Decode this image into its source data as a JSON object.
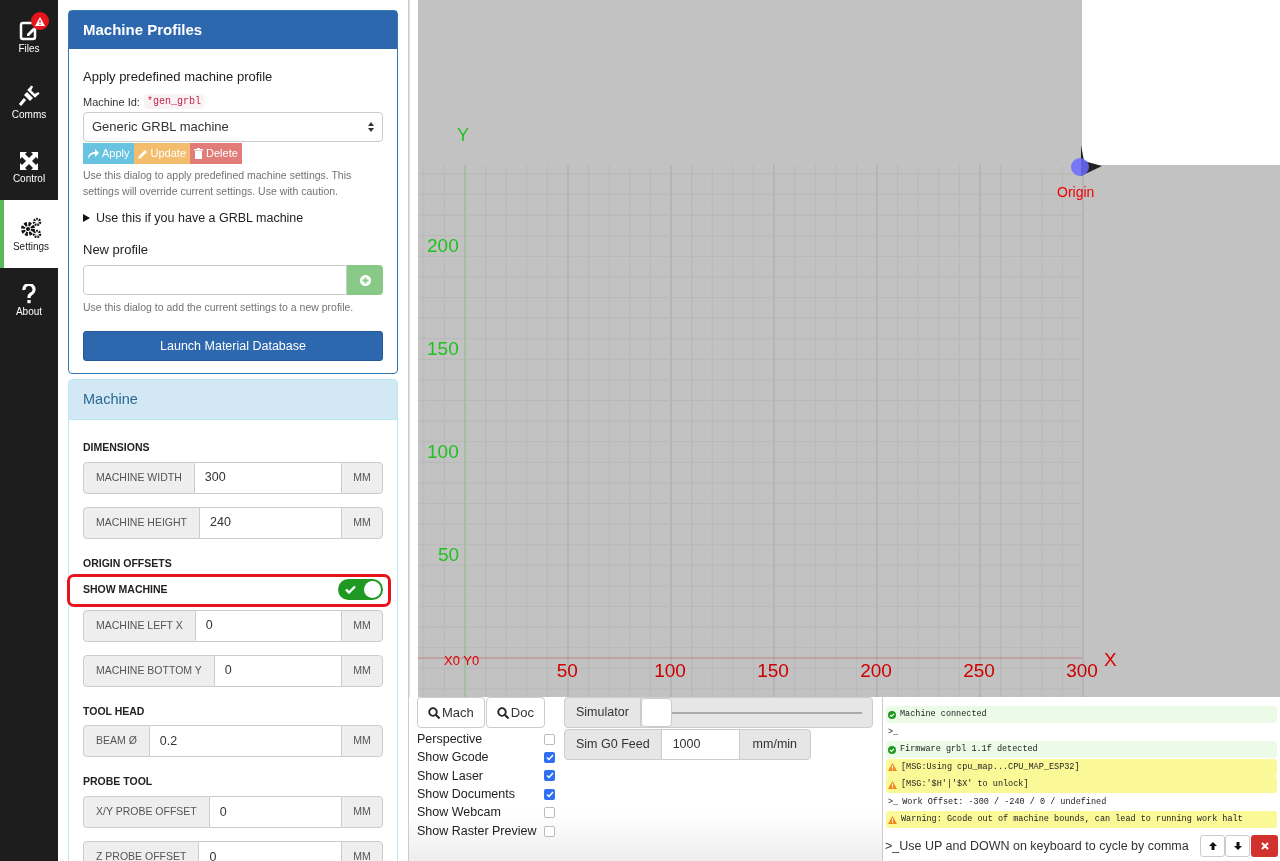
{
  "nav": [
    {
      "label": "Files",
      "badge": true,
      "selected": false
    },
    {
      "label": "Comms",
      "badge": false,
      "selected": false
    },
    {
      "label": "Control",
      "badge": false,
      "selected": false
    },
    {
      "label": "Settings",
      "badge": false,
      "selected": true
    },
    {
      "label": "About",
      "badge": false,
      "selected": false
    }
  ],
  "profiles": {
    "title": "Machine Profiles",
    "subtitle": "Apply predefined machine profile",
    "id_label": "Machine Id:",
    "id_value": "*gen_grbl",
    "select_value": "Generic GRBL machine",
    "buttons": [
      {
        "kind": "apply",
        "label": "Apply"
      },
      {
        "kind": "update",
        "label": "Update"
      },
      {
        "kind": "delete",
        "label": "Delete"
      }
    ],
    "help": "Use this dialog to apply predefined machine settings. This settings will override current settings. Use with caution.",
    "details": {
      "summary": "Use this if you have a GRBL machine",
      "expanded": false
    },
    "new_label": "New profile",
    "new_help": "Use this dialog to add the current settings to a new profile.",
    "launch": "Launch Material Database"
  },
  "machine": {
    "title": "Machine",
    "sections": [
      {
        "heading": "DIMENSIONS",
        "rows": [
          {
            "kind": "input",
            "label": "MACHINE WIDTH",
            "value": "300",
            "unit": "MM"
          },
          {
            "kind": "input",
            "label": "MACHINE HEIGHT",
            "value": "240",
            "unit": "MM"
          }
        ]
      },
      {
        "heading": "ORIGIN OFFSETS",
        "rows": [
          {
            "kind": "toggle",
            "label": "SHOW MACHINE",
            "on": true,
            "highlighted": true
          },
          {
            "kind": "input",
            "label": "MACHINE LEFT X",
            "value": "0",
            "unit": "MM"
          },
          {
            "kind": "input",
            "label": "MACHINE BOTTOM Y",
            "value": "0",
            "unit": "MM"
          }
        ]
      },
      {
        "heading": "TOOL HEAD",
        "rows": [
          {
            "kind": "input",
            "label": "BEAM Ø",
            "value": "0.2",
            "unit": "MM"
          }
        ]
      },
      {
        "heading": "PROBE TOOL",
        "rows": [
          {
            "kind": "input",
            "label": "X/Y PROBE OFFSET",
            "value": "0",
            "unit": "MM"
          },
          {
            "kind": "input",
            "label": "Z PROBE OFFSET",
            "value": "0",
            "unit": "MM"
          }
        ]
      }
    ]
  },
  "viewport": {
    "y_axis": "Y",
    "x_axis": "X",
    "origin": "X0 Y0",
    "marker": "Origin",
    "x_labels": [
      "50",
      "100",
      "150",
      "200",
      "250",
      "300"
    ],
    "y_labels": [
      "200",
      "150",
      "100",
      "50"
    ]
  },
  "view_buttons": [
    "Mach",
    "Doc"
  ],
  "options": [
    {
      "label": "Perspective",
      "checked": false
    },
    {
      "label": "Show Gcode",
      "checked": true
    },
    {
      "label": "Show Laser",
      "checked": true
    },
    {
      "label": "Show Documents",
      "checked": true
    },
    {
      "label": "Show Webcam",
      "checked": false
    },
    {
      "label": "Show Raster Preview",
      "checked": false
    }
  ],
  "simulator": {
    "label": "Simulator",
    "level": 0
  },
  "sim_feed": {
    "label": "Sim G0 Feed",
    "value": "1000",
    "unit": "mm/min"
  },
  "console": {
    "lines": [
      {
        "kind": "success",
        "text": "Machine connected"
      },
      {
        "kind": "prompt",
        "prefix": ">_"
      },
      {
        "kind": "success",
        "text": "Firmware grbl 1.1f detected"
      },
      {
        "kind": "warning",
        "text": "[MSG:Using cpu_map...CPU_MAP_ESP32]"
      },
      {
        "kind": "warning",
        "text": "[MSG:'$H'|'$X' to unlock]"
      },
      {
        "kind": "prompt",
        "prefix": ">_",
        "text": "Work Offset: -300 / -240 / 0 / undefined"
      },
      {
        "kind": "warning",
        "text": "Warning: Gcode out of machine bounds, can lead to running work halt"
      }
    ],
    "prompt": ">_",
    "placeholder": "Use UP and DOWN on keyboard to cycle by comma"
  }
}
